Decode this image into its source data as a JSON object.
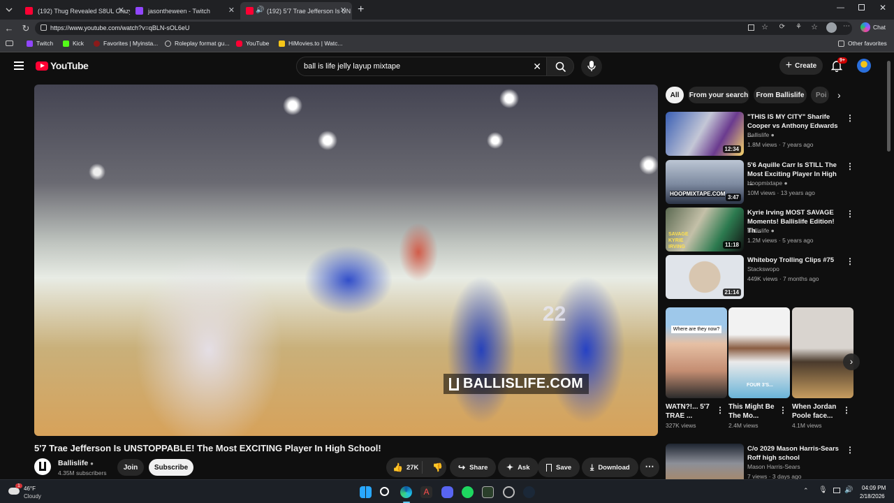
{
  "browser": {
    "tabs": [
      {
        "title": "(192) Thug Revealed S8UL Crazy A",
        "favicon_color": "#ff0033"
      },
      {
        "title": "jasontheween - Twitch",
        "favicon_color": "#9146ff"
      },
      {
        "title": "(192) 5'7 Trae Jefferson Is UN",
        "favicon_color": "#ff0033",
        "active": true
      }
    ],
    "url": "https://www.youtube.com/watch?v=qBLN-sOL6eU",
    "chat_label": "Chat",
    "bookmarks": [
      "Twitch",
      "Kick",
      "Favorites | Myinsta...",
      "Roleplay format gu...",
      "YouTube",
      "HiMovies.to | Watc..."
    ],
    "other_favorites": "Other favorites"
  },
  "youtube": {
    "logo_text": "YouTube",
    "search_query": "ball is life jelly layup mixtape",
    "create_label": "Create",
    "notif_badge": "9+",
    "video": {
      "watermark": "BALLISLIFE.COM",
      "title": "5'7 Trae Jefferson Is UNSTOPPABLE! The Most EXCITING Player In High School!",
      "channel": "Ballislife",
      "subscribers": "4.35M subscribers",
      "join_label": "Join",
      "subscribe_label": "Subscribe",
      "likes": "27K",
      "share_label": "Share",
      "ask_label": "Ask",
      "save_label": "Save",
      "download_label": "Download"
    },
    "chips": [
      "All",
      "From your search",
      "From Ballislife",
      "Poi"
    ],
    "recommendations": [
      {
        "title": "\"THIS IS MY CITY\" Sharife Cooper vs Anthony Edwards ...",
        "channel": "Ballislife",
        "meta": "1.8M views · 7 years ago",
        "duration": "12:34",
        "verified": true
      },
      {
        "title": "5'6 Aquille Carr Is STILL The Most Exciting Player In High ...",
        "channel": "Hoopmixtape",
        "meta": "10M views · 13 years ago",
        "duration": "3:47",
        "verified": true
      },
      {
        "title": "Kyrie Irving MOST SAVAGE Moments! Ballislife Edition! Th...",
        "channel": "Ballislife",
        "meta": "1.2M views · 5 years ago",
        "duration": "11:18",
        "verified": true
      },
      {
        "title": "Whiteboy Trolling Clips #75",
        "channel": "Stackswopo",
        "meta": "449K views · 7 months ago",
        "duration": "21:14",
        "verified": false
      }
    ],
    "shorts": [
      {
        "title": "WATN?!... 5'7 TRAE ...",
        "views": "327K views",
        "overlay": "Where are they now?"
      },
      {
        "title": "This Might Be The Mo...",
        "views": "2.4M views",
        "overlay": "FOUR 3'S..."
      },
      {
        "title": "When Jordan Poole face...",
        "views": "4.1M views",
        "overlay": ""
      }
    ],
    "last_rec": {
      "title": "C/o 2029 Mason Harris-Sears Roff high school",
      "channel": "Mason Harris-Sears",
      "meta": "7 views · 3 days ago"
    },
    "thumb_texts": [
      "HOOPMIXTAPE.COM",
      "SAVAGE KYRIE IRVING"
    ]
  },
  "taskbar": {
    "weather_temp": "46°F",
    "weather_desc": "Cloudy",
    "weather_badge": "1",
    "time": "04:09 PM",
    "date": "2/18/2026"
  },
  "colors": {
    "yt_red": "#ff0033",
    "bg": "#0f0f0f",
    "chip_active": "#f1f1f1"
  }
}
